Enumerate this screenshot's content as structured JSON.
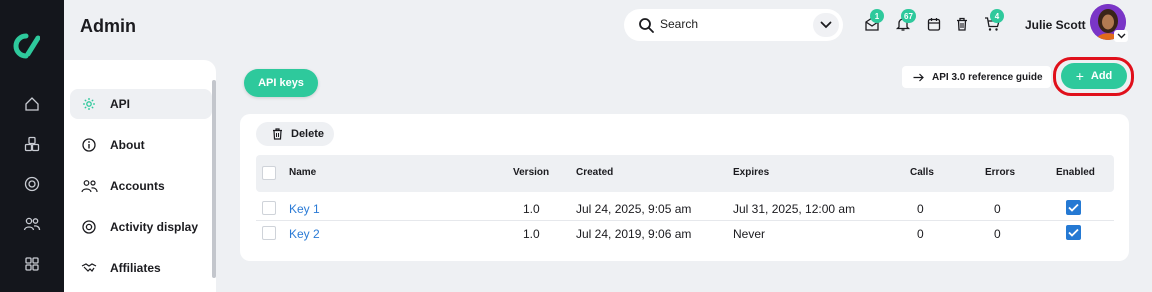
{
  "header": {
    "title": "Admin",
    "search_placeholder": "Search",
    "badges": {
      "messages": "1",
      "notifications": "67",
      "cart": "4"
    },
    "user_name": "Julie Scott"
  },
  "rail": {
    "icons": [
      "logo",
      "home-icon",
      "cubes-icon",
      "target-icon",
      "users-icon",
      "apps-grid-icon"
    ]
  },
  "sidebar": {
    "items": [
      {
        "label": "API",
        "icon": "gear-icon",
        "active": true
      },
      {
        "label": "About",
        "icon": "info-icon",
        "active": false
      },
      {
        "label": "Accounts",
        "icon": "users-icon",
        "active": false
      },
      {
        "label": "Activity display",
        "icon": "target-icon",
        "active": false
      },
      {
        "label": "Affiliates",
        "icon": "handshake-icon",
        "active": false
      }
    ]
  },
  "tabs": [
    {
      "label": "API keys",
      "active": true
    }
  ],
  "toolbar": {
    "ref_guide": "API 3.0 reference guide",
    "add": "Add",
    "delete": "Delete"
  },
  "table": {
    "columns": [
      "Name",
      "Version",
      "Created",
      "Expires",
      "Calls",
      "Errors",
      "Enabled"
    ],
    "rows": [
      {
        "name": "Key 1",
        "version": "1.0",
        "created": "Jul 24, 2025, 9:05 am",
        "expires": "Jul 31, 2025, 12:00 am",
        "calls": "0",
        "errors": "0",
        "enabled": true
      },
      {
        "name": "Key 2",
        "version": "1.0",
        "created": "Jul 24, 2019, 9:06 am",
        "expires": "Never",
        "calls": "0",
        "errors": "0",
        "enabled": true
      }
    ]
  },
  "colors": {
    "accent": "#2ec99c",
    "rail": "#14161c",
    "link": "#2b7bd6",
    "highlight": "#e0101b",
    "checkbox": "#2579d3"
  }
}
